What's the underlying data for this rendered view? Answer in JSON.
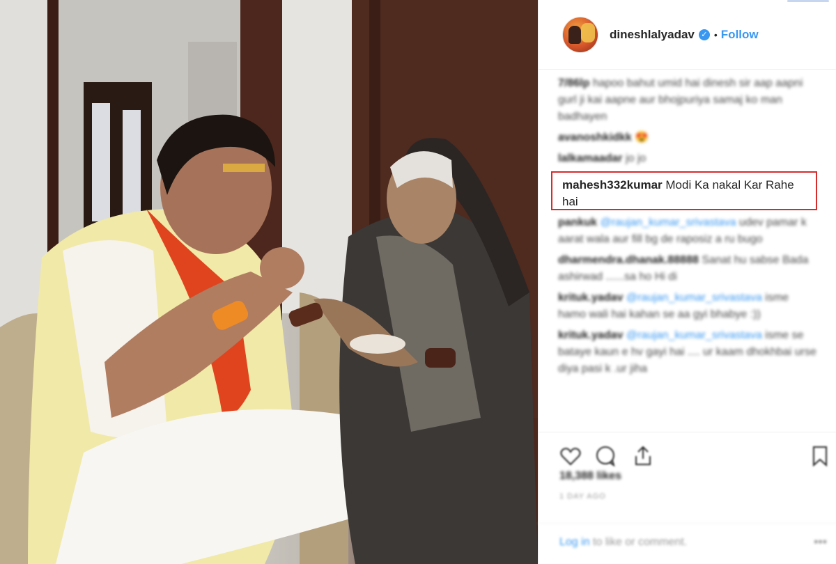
{
  "post": {
    "username": "dineshlalyadav",
    "verified_icon": "check-icon",
    "separator": "•",
    "follow_label": "Follow"
  },
  "comments": [
    {
      "user": "7/86lp",
      "text": "hapoo bahut umid hai dinesh sir aap aapni gurl ji kai aapne aur bhojpuriya samaj ko man badhayen",
      "mention": ""
    },
    {
      "user": "avanoshkidkk",
      "text": "😍",
      "mention": ""
    },
    {
      "user": "lalkamaadar",
      "text": "jo jo",
      "mention": ""
    }
  ],
  "highlighted_comment": {
    "user": "mahesh332kumar",
    "text": "Modi Ka nakal Kar Rahe hai"
  },
  "comments_after": [
    {
      "user": "pankuk",
      "mention": "@raujan_kumar_srivastava",
      "text": "udev pamar k aarat wala aur fill bg de raposiz a ru bugo"
    },
    {
      "user": "dharmendra.dhanak.88888",
      "mention": "",
      "text": "Sanat hu sabse Bada ashirwad ......sa ho Hi di"
    },
    {
      "user": "krituk.yadav",
      "mention": "@raujan_kumar_srivastava",
      "text": "isme hamo wali hai kahan se aa gyi bhabye :))"
    },
    {
      "user": "krituk.yadav",
      "mention": "@raujan_kumar_srivastava",
      "text": "isme se bataye kaun e hv gayi hai .... ur kaam dhokhbai urse diya pasi k .ur jiha"
    }
  ],
  "actions": {
    "like_icon": "heart-icon",
    "comment_icon": "comment-icon",
    "share_icon": "share-icon",
    "save_icon": "bookmark-icon",
    "likes_text": "18,388 likes",
    "date_text": "1 DAY AGO"
  },
  "add_comment": {
    "login_label": "Log in",
    "rest_text": "to like or comment.",
    "more_label": "•••"
  },
  "colors": {
    "accent": "#3897f0",
    "highlight_border": "#d62b2b",
    "text": "#262626"
  }
}
